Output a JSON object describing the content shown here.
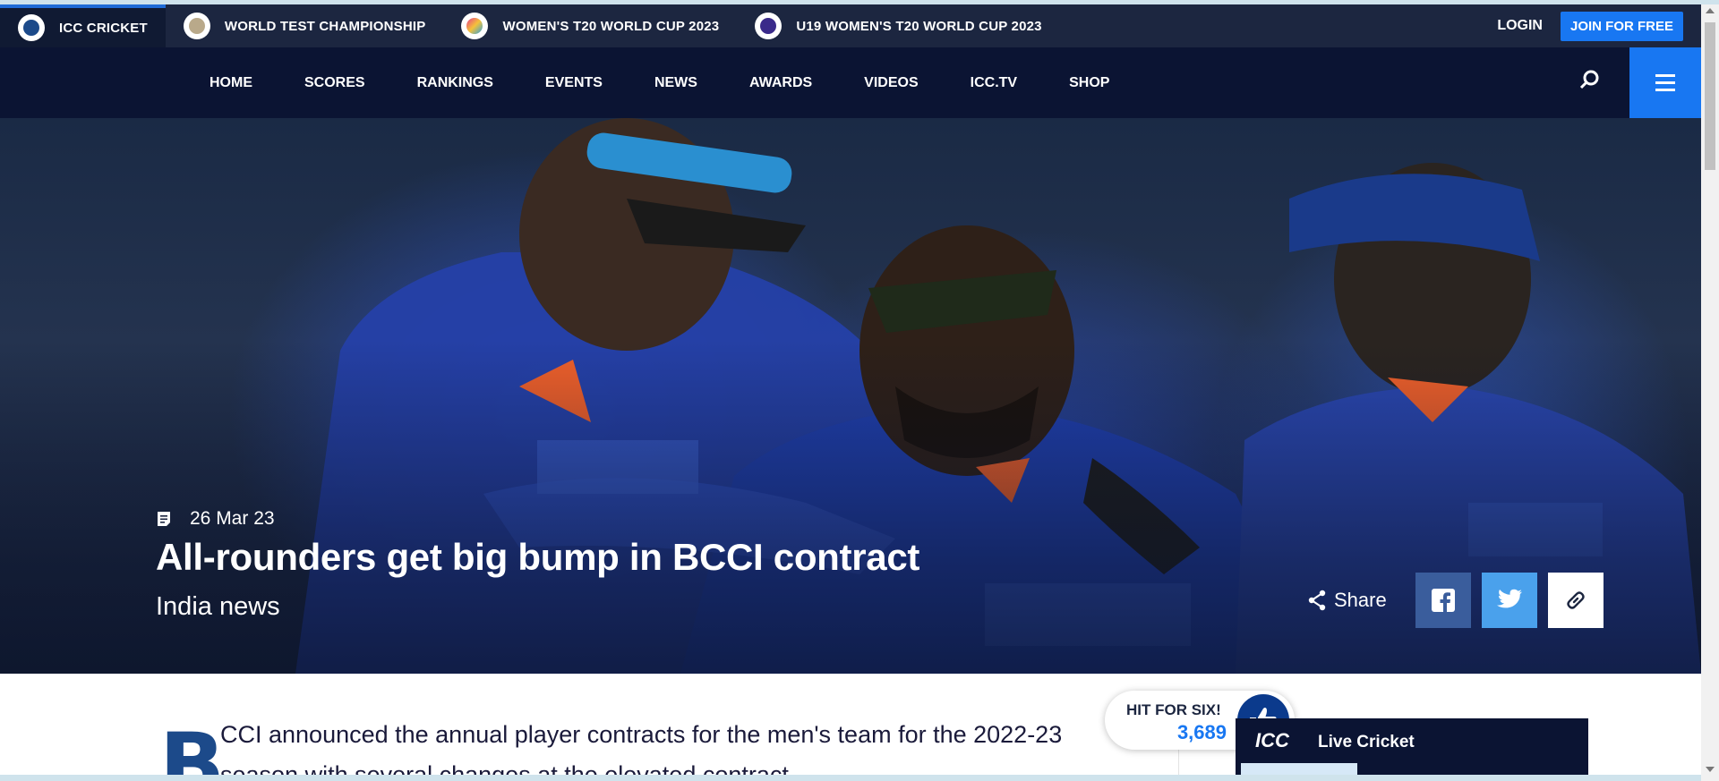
{
  "tournament_bar": {
    "items": [
      {
        "label": "ICC CRICKET",
        "icon": "icc-logo-icon",
        "active": true
      },
      {
        "label": "WORLD TEST CHAMPIONSHIP",
        "icon": "wtc-logo-icon",
        "active": false
      },
      {
        "label": "WOMEN'S T20 WORLD CUP 2023",
        "icon": "womens-t20-logo-icon",
        "active": false
      },
      {
        "label": "U19 WOMEN'S T20 WORLD CUP 2023",
        "icon": "u19-womens-t20-logo-icon",
        "active": false
      }
    ],
    "login_label": "LOGIN",
    "join_label": "JOIN FOR FREE"
  },
  "main_nav": {
    "items": [
      "HOME",
      "SCORES",
      "RANKINGS",
      "EVENTS",
      "NEWS",
      "AWARDS",
      "VIDEOS",
      "ICC.TV",
      "SHOP"
    ]
  },
  "hero": {
    "date": "26 Mar 23",
    "headline": "All-rounders get big bump in BCCI contract",
    "category": "India news",
    "share_label": "Share"
  },
  "article": {
    "dropcap": "B",
    "lead_line1": "CCI announced the annual player contracts for the men's team for the 2022-23",
    "lead_line2": "season with several changes at the elevated contract"
  },
  "hit_for_six": {
    "label": "HIT FOR SIX!",
    "count": "3,689"
  },
  "live_cricket": {
    "logo": "ICC",
    "title": "Live Cricket"
  },
  "colors": {
    "nav_dark": "#0b1433",
    "tourney_bar": "#1c2640",
    "accent_blue": "#1877f2",
    "facebook": "#3a5d9c",
    "twitter": "#4aa1ec"
  }
}
